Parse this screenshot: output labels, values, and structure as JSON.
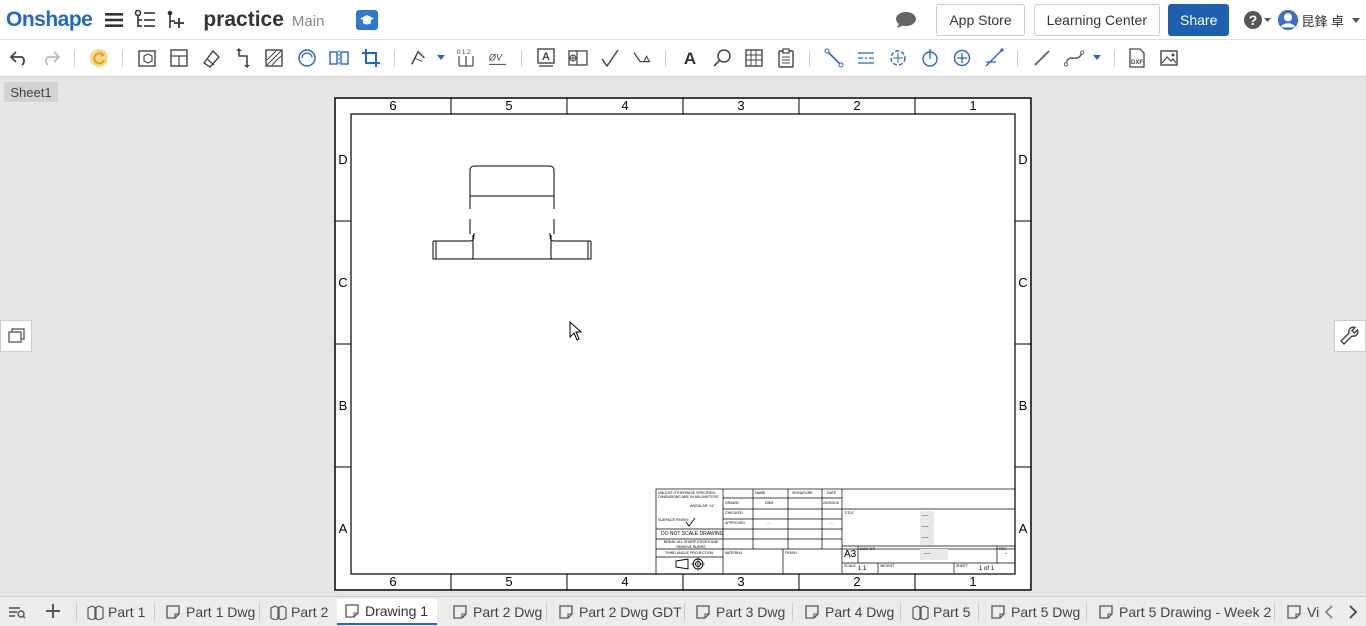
{
  "app": {
    "logo": "Onshape",
    "document_name": "practice",
    "branch": "Main"
  },
  "header": {
    "app_store": "App Store",
    "learning_center": "Learning Center",
    "share": "Share",
    "user_name": "昆鋒 卓"
  },
  "sheet": {
    "tab_label": "Sheet1"
  },
  "drawing": {
    "columns_top": [
      "6",
      "5",
      "4",
      "3",
      "2",
      "1"
    ],
    "columns_bottom": [
      "6",
      "5",
      "4",
      "3",
      "2",
      "1"
    ],
    "rows_left": [
      "D",
      "C",
      "B",
      "A"
    ],
    "rows_right": [
      "D",
      "C",
      "B",
      "A"
    ],
    "title_block": {
      "unless_note": "UNLESS OTHERWISE SPECIFIED:",
      "dims_note": "DIMENSIONS ARE IN MILLIMETERS",
      "angular": "ANGULAR: ±1°",
      "surface_finish": "SURFACE FINISH:",
      "do_not_scale": "DO NOT SCALE DRAWING",
      "break_edges": "BREAK ALL SHARP EDGES AND REMOVE BURRS",
      "third_angle": "THIRD ANGLE PROJECTION",
      "material": "MATERIAL",
      "finish": "FINISH",
      "name": "NAME",
      "signature": "SIGNATURE",
      "date": "DATE",
      "drawn": "DRAWN",
      "drawn_by": "DNM",
      "drawn_date": "2025/5/15",
      "checked": "CHECKED",
      "approved": "APPROVED",
      "approved_name": "----",
      "approved_date": "----",
      "title_label": "TITLE",
      "title_values": [
        "----",
        "----",
        "----"
      ],
      "size": "A3",
      "dwg_no_label": "DWG NO",
      "dwg_no": "----",
      "rev_label": "REV",
      "rev": "-",
      "scale_label": "SCALE",
      "scale": "1:1",
      "weight_label": "WEIGHT",
      "sheet_label": "SHEET",
      "sheet": "1 of 1"
    }
  },
  "bottom_tabs": [
    {
      "label": "Part 1",
      "type": "part-studio"
    },
    {
      "label": "Part 1 Dwg",
      "type": "drawing"
    },
    {
      "label": "Part 2",
      "type": "part-studio"
    },
    {
      "label": "Drawing 1",
      "type": "drawing",
      "active": true
    },
    {
      "label": "Part 2 Dwg",
      "type": "drawing"
    },
    {
      "label": "Part 2 Dwg GDT",
      "type": "drawing"
    },
    {
      "label": "Part 3 Dwg",
      "type": "drawing"
    },
    {
      "label": "Part 4 Dwg",
      "type": "drawing"
    },
    {
      "label": "Part 5",
      "type": "part-studio"
    },
    {
      "label": "Part 5 Dwg",
      "type": "drawing"
    },
    {
      "label": "Part 5 Drawing - Week 2",
      "type": "drawing"
    },
    {
      "label": "Vi",
      "type": "drawing"
    }
  ],
  "colors": {
    "brand": "#2168c8",
    "share": "#1f5fb0",
    "canvas": "#e6e6e6"
  }
}
